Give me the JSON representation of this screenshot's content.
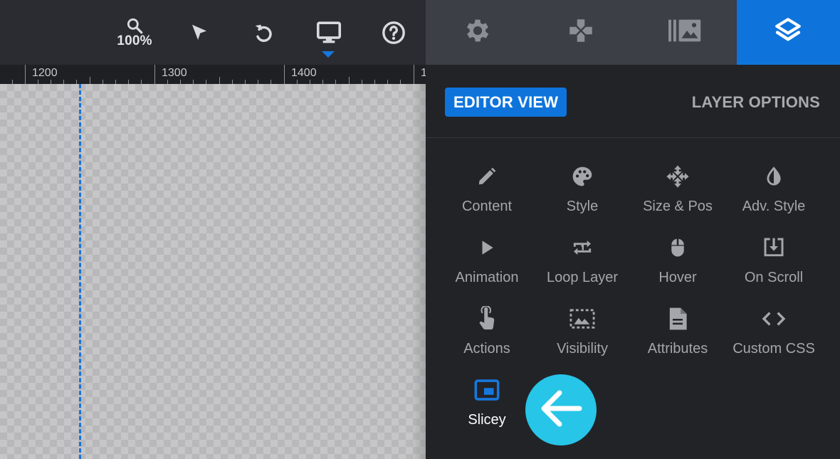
{
  "toolbar": {
    "zoom_label": "100%",
    "icons": [
      "zoom-icon",
      "cursor-arrow-icon",
      "undo-icon",
      "desktop-monitor-icon",
      "help-icon"
    ]
  },
  "tabs": [
    {
      "name": "settings",
      "icon": "gear-icon",
      "active": false
    },
    {
      "name": "gamepad",
      "icon": "gamepad-icon",
      "active": false
    },
    {
      "name": "media",
      "icon": "media-gallery-icon",
      "active": false
    },
    {
      "name": "layers",
      "icon": "layers-icon",
      "active": true
    }
  ],
  "ruler": {
    "labels": [
      "1200",
      "1300",
      "1400",
      "1"
    ]
  },
  "panel": {
    "editor_view": "EDITOR VIEW",
    "layer_options": "LAYER OPTIONS",
    "options": [
      {
        "label": "Content",
        "icon": "pencil-icon"
      },
      {
        "label": "Style",
        "icon": "palette-icon"
      },
      {
        "label": "Size & Pos",
        "icon": "move-arrows-icon"
      },
      {
        "label": "Adv. Style",
        "icon": "drop-icon"
      },
      {
        "label": "Animation",
        "icon": "play-icon"
      },
      {
        "label": "Loop Layer",
        "icon": "loop-icon"
      },
      {
        "label": "Hover",
        "icon": "mouse-icon"
      },
      {
        "label": "On Scroll",
        "icon": "scroll-download-icon"
      },
      {
        "label": "Actions",
        "icon": "touch-hand-icon"
      },
      {
        "label": "Visibility",
        "icon": "image-dashed-icon"
      },
      {
        "label": "Attributes",
        "icon": "document-icon"
      },
      {
        "label": "Custom CSS",
        "icon": "code-icon"
      },
      {
        "label": "Slicey",
        "icon": "picture-in-picture-icon",
        "active": true
      }
    ]
  },
  "colors": {
    "accent": "#0e74dc",
    "back_button": "#27c5e7",
    "guide": "#1a73d9"
  }
}
